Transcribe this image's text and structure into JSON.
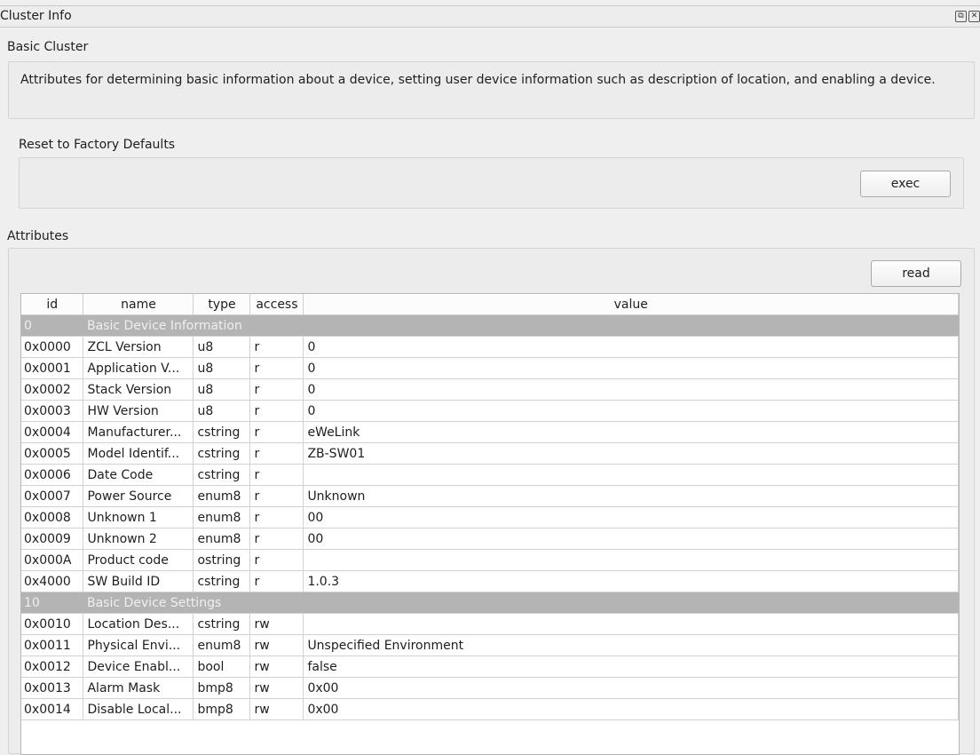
{
  "window": {
    "title": "Cluster Info",
    "float_icon": "⧉",
    "close_icon": "✕"
  },
  "cluster": {
    "name": "Basic Cluster",
    "description": "Attributes for determining basic information about a device, setting user device information such as description of location, and enabling a device."
  },
  "reset": {
    "label": "Reset to Factory Defaults",
    "button": "exec"
  },
  "attributes": {
    "label": "Attributes",
    "read_button": "read",
    "columns": {
      "id": "id",
      "name": "name",
      "type": "type",
      "access": "access",
      "value": "value"
    },
    "groups": [
      {
        "id": "0",
        "name": "Basic Device Information",
        "rows": [
          {
            "id": "0x0000",
            "name": "ZCL Version",
            "type": "u8",
            "access": "r",
            "value": "0"
          },
          {
            "id": "0x0001",
            "name": "Application V...",
            "type": "u8",
            "access": "r",
            "value": "0"
          },
          {
            "id": "0x0002",
            "name": "Stack Version",
            "type": "u8",
            "access": "r",
            "value": "0"
          },
          {
            "id": "0x0003",
            "name": "HW Version",
            "type": "u8",
            "access": "r",
            "value": "0"
          },
          {
            "id": "0x0004",
            "name": "Manufacturer...",
            "type": "cstring",
            "access": "r",
            "value": "eWeLink"
          },
          {
            "id": "0x0005",
            "name": "Model Identif...",
            "type": "cstring",
            "access": "r",
            "value": "ZB-SW01"
          },
          {
            "id": "0x0006",
            "name": "Date Code",
            "type": "cstring",
            "access": "r",
            "value": ""
          },
          {
            "id": "0x0007",
            "name": "Power Source",
            "type": "enum8",
            "access": "r",
            "value": "Unknown"
          },
          {
            "id": "0x0008",
            "name": "Unknown 1",
            "type": "enum8",
            "access": "r",
            "value": "00"
          },
          {
            "id": "0x0009",
            "name": "Unknown 2",
            "type": "enum8",
            "access": "r",
            "value": "00"
          },
          {
            "id": "0x000A",
            "name": "Product code",
            "type": "ostring",
            "access": "r",
            "value": ""
          },
          {
            "id": "0x4000",
            "name": "SW Build ID",
            "type": "cstring",
            "access": "r",
            "value": "1.0.3"
          }
        ]
      },
      {
        "id": "10",
        "name": "Basic Device Settings",
        "rows": [
          {
            "id": "0x0010",
            "name": "Location Des...",
            "type": "cstring",
            "access": "rw",
            "value": ""
          },
          {
            "id": "0x0011",
            "name": "Physical Envi...",
            "type": "enum8",
            "access": "rw",
            "value": "Unspecified Environment"
          },
          {
            "id": "0x0012",
            "name": "Device Enabl...",
            "type": "bool",
            "access": "rw",
            "value": "false"
          },
          {
            "id": "0x0013",
            "name": "Alarm Mask",
            "type": "bmp8",
            "access": "rw",
            "value": "0x00"
          },
          {
            "id": "0x0014",
            "name": "Disable Local...",
            "type": "bmp8",
            "access": "rw",
            "value": "0x00"
          }
        ]
      }
    ]
  }
}
